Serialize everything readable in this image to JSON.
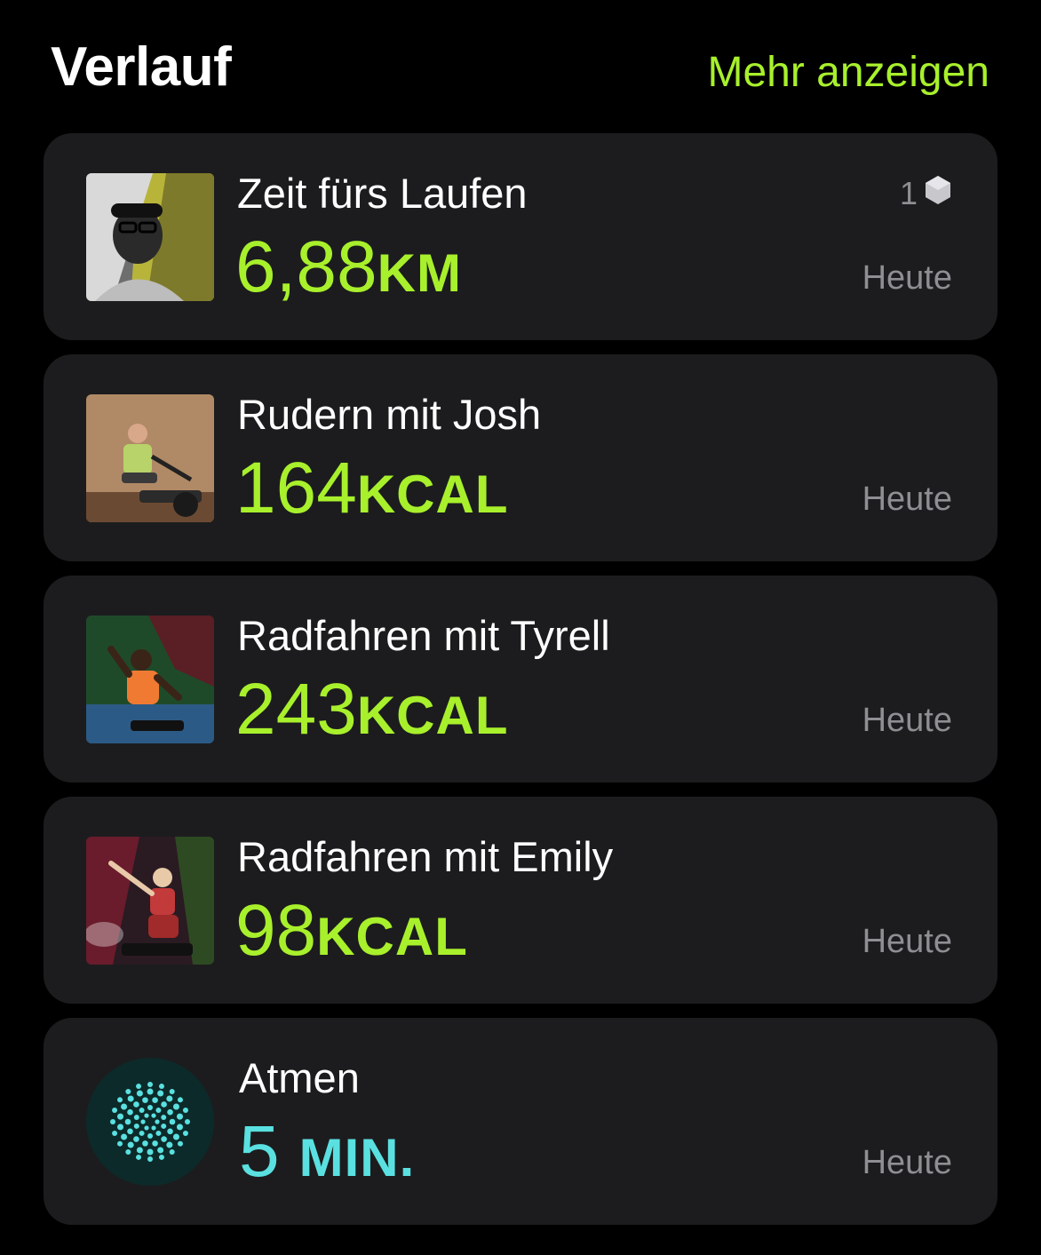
{
  "header": {
    "title": "Verlauf",
    "more_label": "Mehr anzeigen"
  },
  "colors": {
    "accent_green": "#a8f02c",
    "accent_teal": "#5ae0e0",
    "card_bg": "#1c1c1e",
    "secondary_text": "#8e8e93"
  },
  "history": [
    {
      "title": "Zeit fürs Laufen",
      "value": "6,88",
      "unit": "KM",
      "date": "Heute",
      "badge_count": "1",
      "badge_icon": "award-hexagon-icon",
      "thumb": "runner-portrait"
    },
    {
      "title": "Rudern mit Josh",
      "value": "164",
      "unit": "KCAL",
      "date": "Heute",
      "thumb": "rowing-trainer"
    },
    {
      "title": "Radfahren mit Tyrell",
      "value": "243",
      "unit": "KCAL",
      "date": "Heute",
      "thumb": "cycling-trainer-tyrell"
    },
    {
      "title": "Radfahren mit Emily",
      "value": "98",
      "unit": "KCAL",
      "date": "Heute",
      "thumb": "cycling-trainer-emily"
    },
    {
      "title": "Atmen",
      "value": "5",
      "unit": "MIN.",
      "date": "Heute",
      "thumb": "breathe-icon"
    }
  ]
}
